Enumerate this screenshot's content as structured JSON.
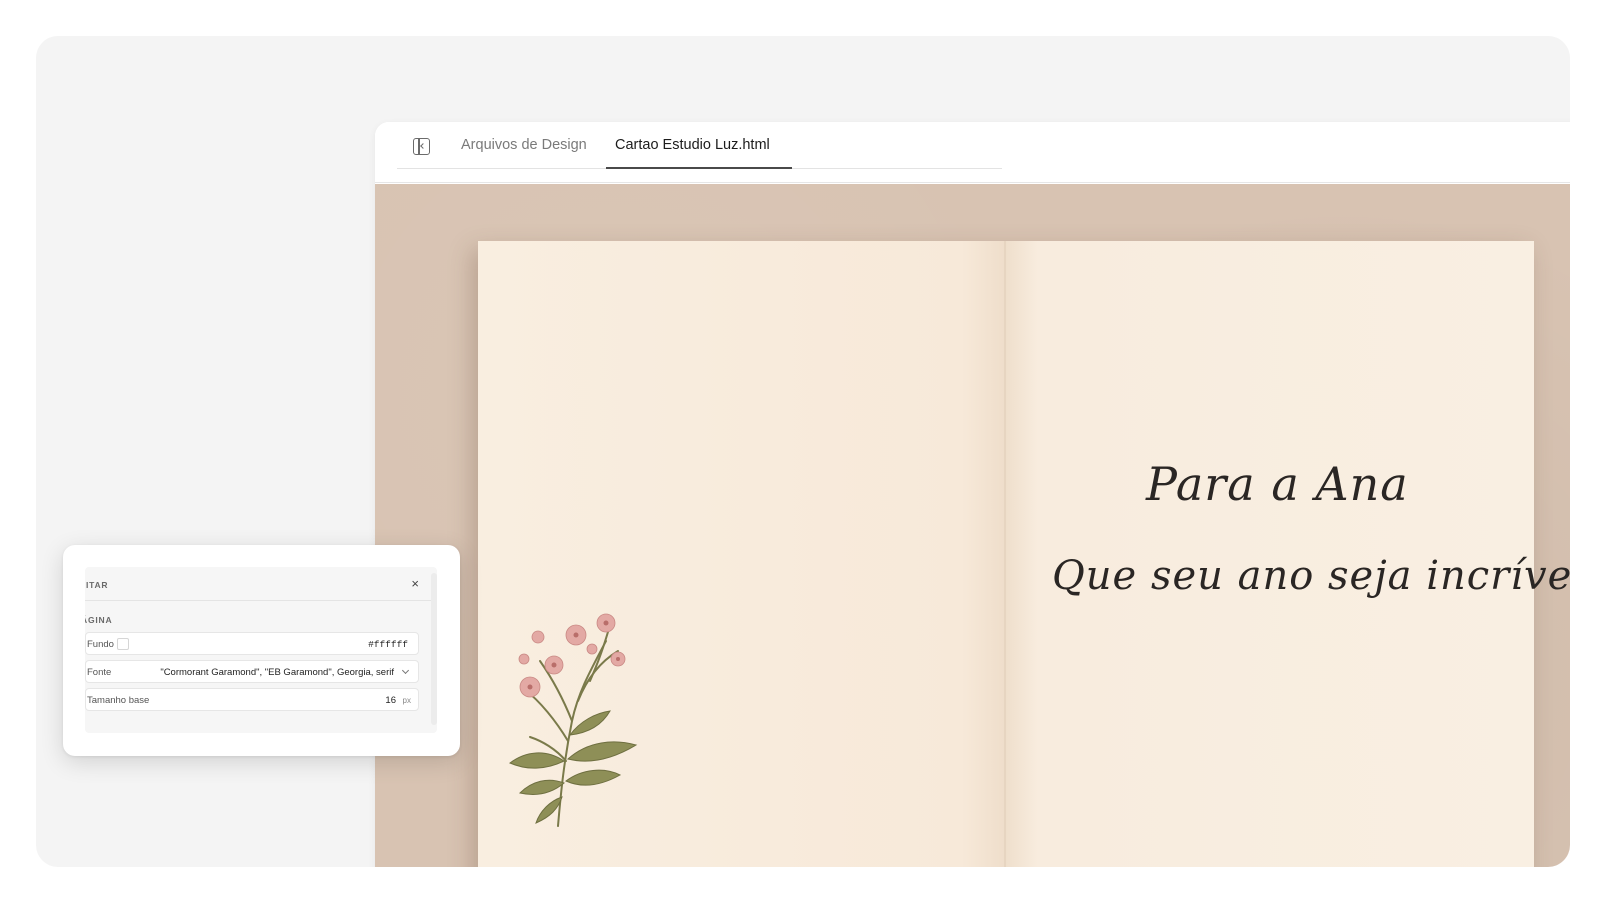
{
  "tabs": {
    "design_files": "Arquivos de Design",
    "active_file": "Cartao Estudio Luz.html"
  },
  "card": {
    "greeting": "Para a Ana",
    "message": "Que seu ano seja incrível"
  },
  "edit_panel": {
    "title": "DITAR",
    "close_label": "×",
    "section": "ÁGINA",
    "background": {
      "label": "Fundo",
      "value": "#ffffff"
    },
    "font": {
      "label": "Fonte",
      "value": "\"Cormorant Garamond\", \"EB Garamond\", Georgia, serif"
    },
    "base_size": {
      "label": "Tamanho base",
      "value": "16",
      "unit": "px"
    }
  },
  "colors": {
    "canvas_background": "#d8c3b2",
    "card_paper": "#f8ecdd",
    "active_tab_underline": "#4a4a4a"
  },
  "icons": {
    "sidebar_toggle": "sidebar-toggle-icon",
    "flower": "flower-illustration"
  }
}
